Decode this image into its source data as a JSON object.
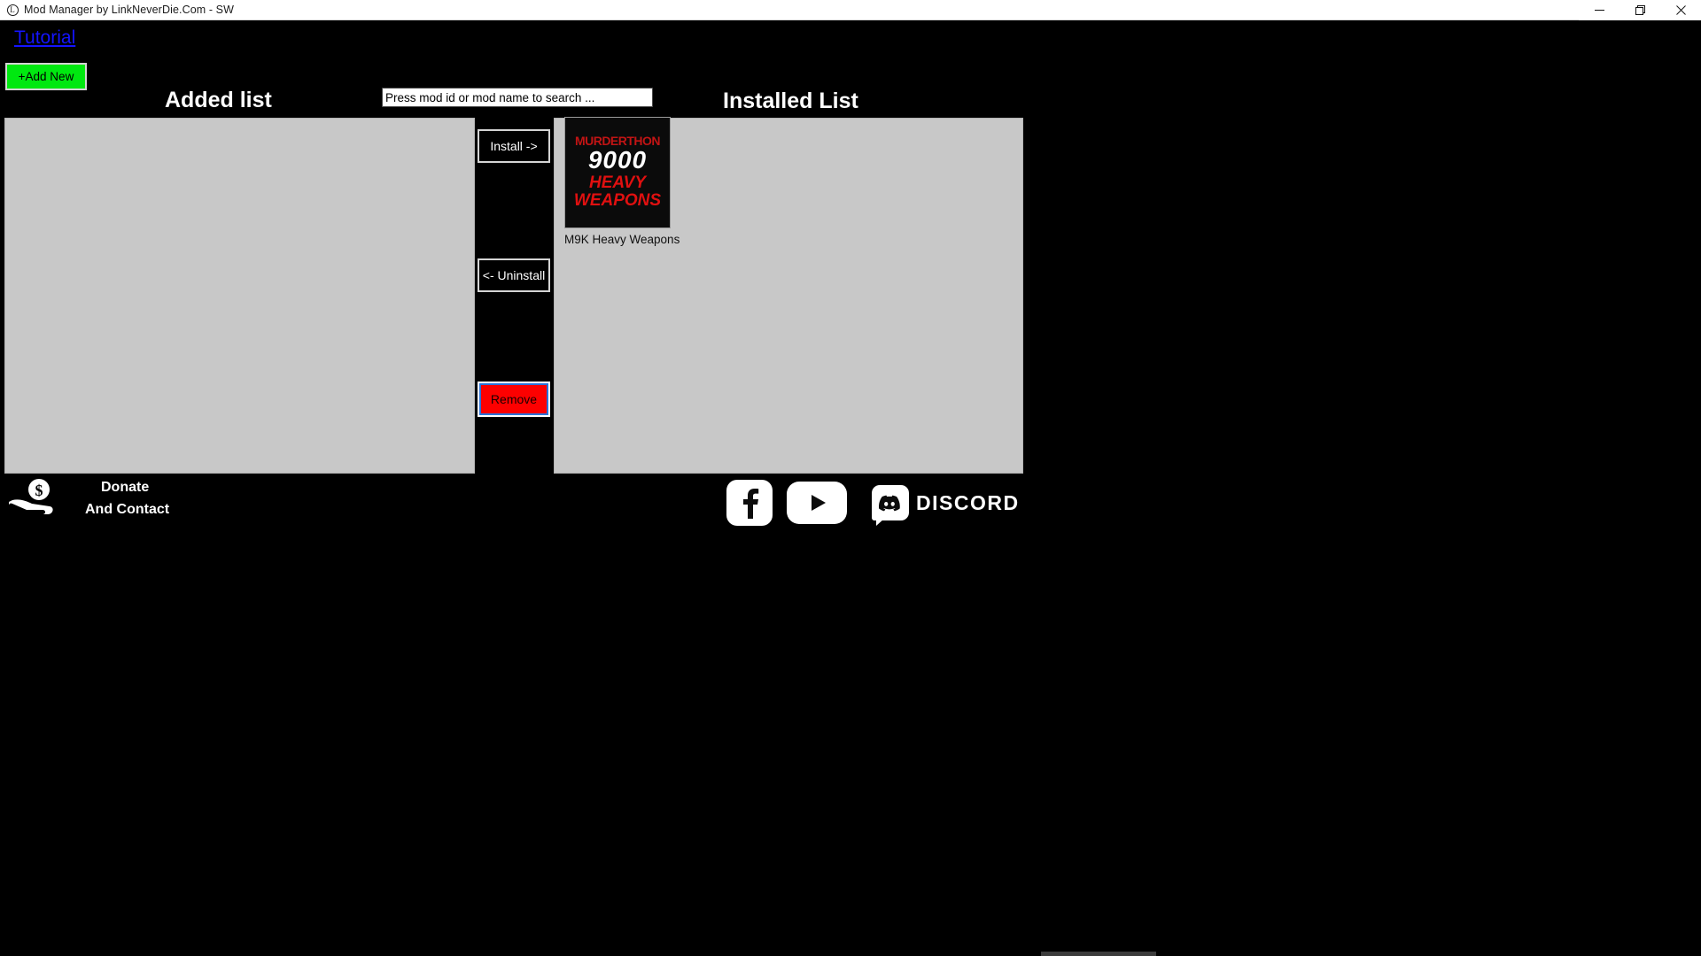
{
  "window": {
    "title": "Mod Manager by LinkNeverDie.Com - SW",
    "app_icon": "circled-l-icon",
    "controls": {
      "minimize": "minimize-icon",
      "maximize": "restore-icon",
      "close": "close-icon"
    }
  },
  "toolbar": {
    "tutorial_label": "Tutorial",
    "add_new_label": "+Add New"
  },
  "search": {
    "placeholder": "Press mod id or mod name to search ...",
    "value": ""
  },
  "panels": {
    "added": {
      "heading": "Added list",
      "items": []
    },
    "installed": {
      "heading": "Installed List",
      "items": [
        {
          "label": "M9K Heavy Weapons",
          "thumb_line1": "MURDERTHON",
          "thumb_line2": "9000",
          "thumb_line3": "HEAVY",
          "thumb_line4": "WEAPONS"
        }
      ]
    }
  },
  "actions": {
    "install_label": "Install ->",
    "uninstall_label": "<- Uninstall",
    "remove_label": "Remove"
  },
  "donate": {
    "icon": "hand-holding-coin-icon",
    "line1": "Donate",
    "line2": "And Contact"
  },
  "socials": [
    {
      "name": "facebook-icon",
      "label": ""
    },
    {
      "name": "youtube-icon",
      "label": ""
    },
    {
      "name": "discord-icon",
      "label": "DISCORD"
    }
  ],
  "colors": {
    "background": "#000000",
    "panel": "#c8c8c8",
    "add_new": "#00e810",
    "remove": "#fd0000",
    "link": "#1414ff",
    "focus_ring": "#2a72d8"
  }
}
